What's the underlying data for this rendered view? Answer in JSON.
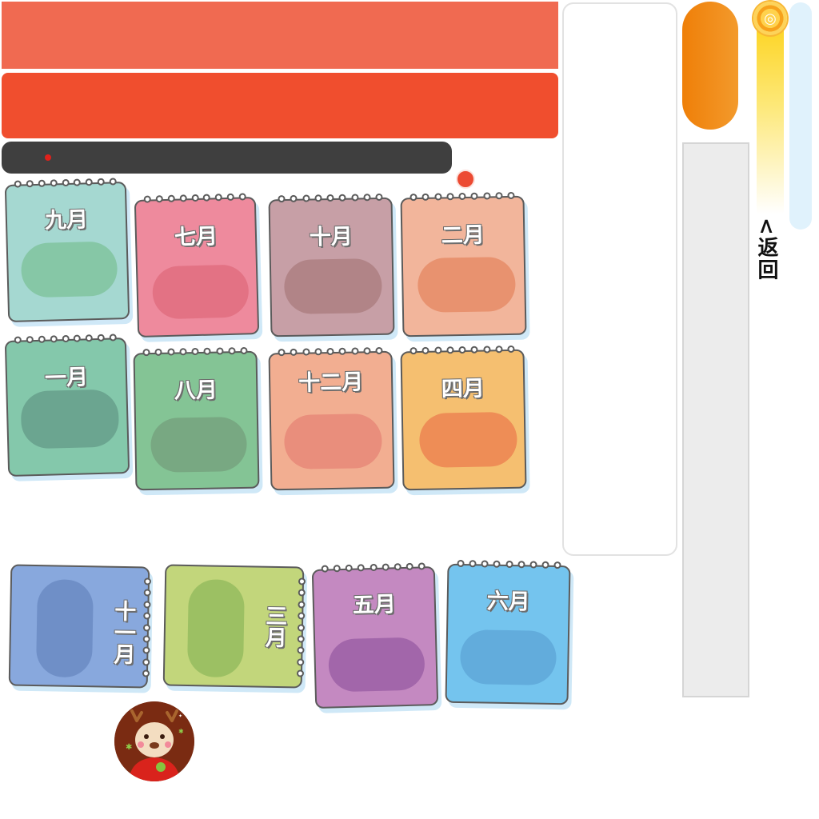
{
  "header": {
    "back_label": "<返回",
    "coin_symbol": "◎"
  },
  "months": {
    "sep": "九月",
    "jul": "七月",
    "oct": "十月",
    "feb": "二月",
    "jan": "一月",
    "aug": "八月",
    "dec": "十二月",
    "apr": "四月",
    "nov": "十一月",
    "mar": "三月",
    "may": "五月",
    "jun": "六月"
  },
  "colors": {
    "banner_top": "#f06a51",
    "banner_mid": "#f04e2e",
    "dark_bar": "#3f3f3f",
    "orange_pill": "#ef7f08",
    "accent_red": "#ec4a32"
  },
  "icons": {
    "coin": "coin-icon",
    "avatar": "reindeer-avatar-icon",
    "notification": "red-dot-icon"
  }
}
